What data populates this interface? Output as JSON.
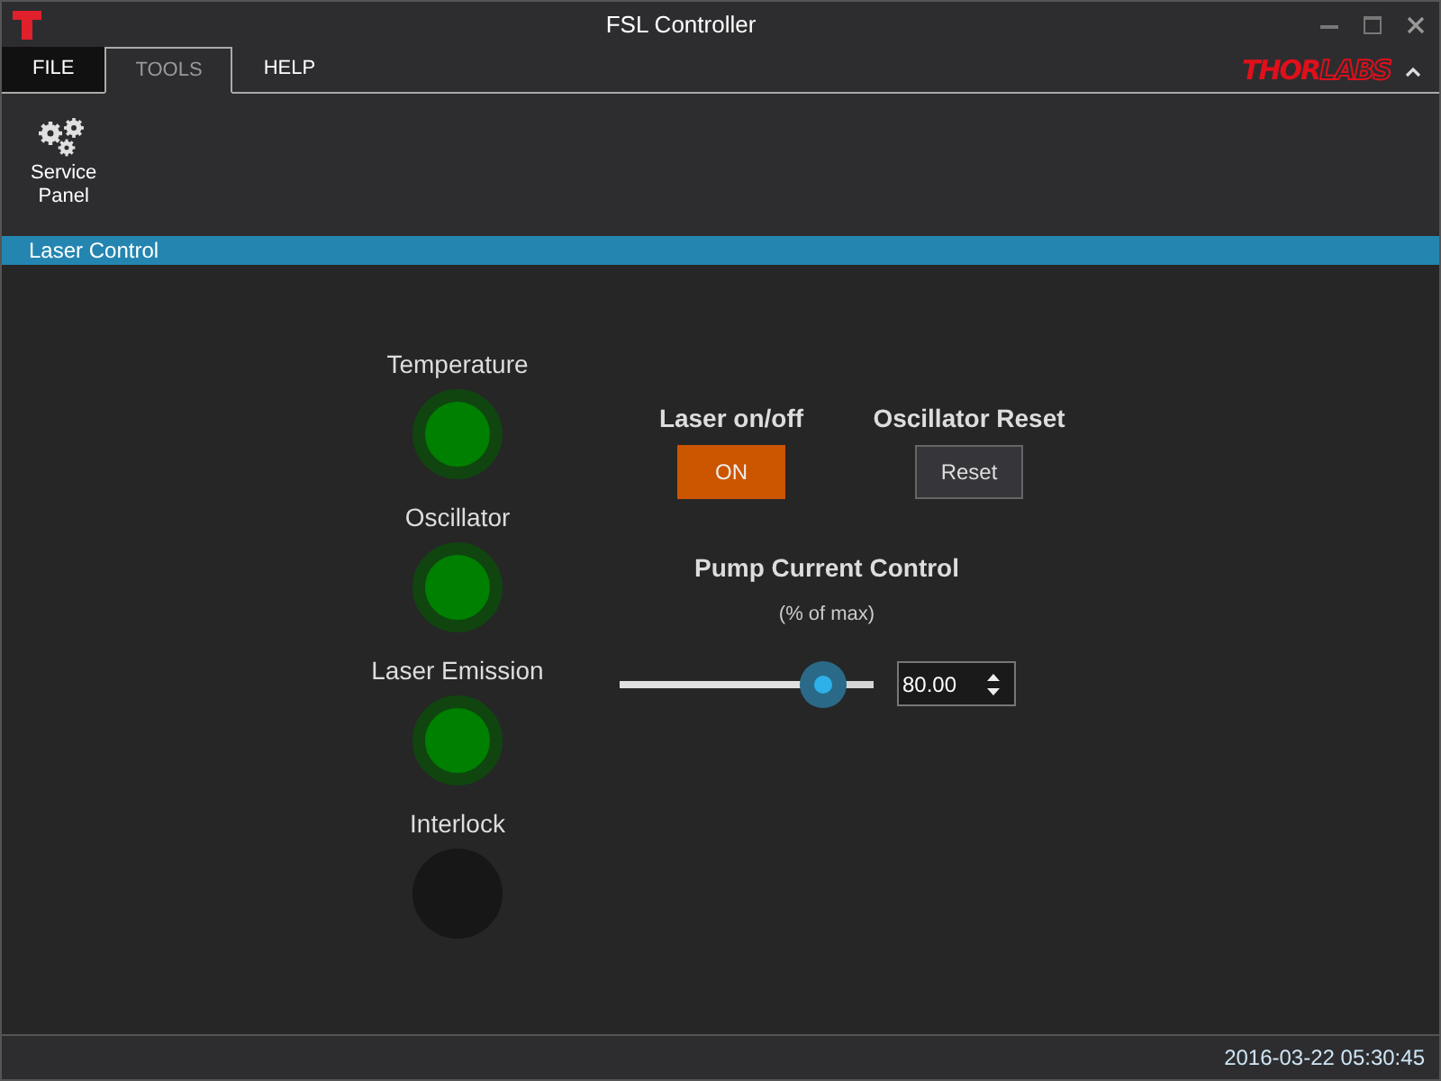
{
  "window": {
    "title": "FSL Controller"
  },
  "tabs": [
    {
      "label": "FILE",
      "selected": false,
      "kind": "file"
    },
    {
      "label": "TOOLS",
      "selected": true,
      "kind": "tab"
    },
    {
      "label": "HELP",
      "selected": false,
      "kind": "tab"
    }
  ],
  "brand": {
    "part_1": "THOR",
    "part_2": "LABS"
  },
  "ribbon": {
    "items": [
      {
        "label": "Service\nPanel"
      }
    ]
  },
  "section": {
    "title": "Laser Control"
  },
  "indicators": [
    {
      "label": "Temperature",
      "on": true
    },
    {
      "label": "Oscillator",
      "on": true
    },
    {
      "label": "Laser Emission",
      "on": true
    },
    {
      "label": "Interlock",
      "on": false
    }
  ],
  "laser": {
    "label": "Laser on/off",
    "button": "ON",
    "on": true
  },
  "oscillator_reset": {
    "label": "Oscillator Reset",
    "button": "Reset"
  },
  "pump": {
    "title": "Pump Current Control",
    "subtitle": "(% of max)",
    "level": 0.8,
    "value": "80.00"
  },
  "status_bar": {
    "datetime": "2016-03-22 05:30:45"
  }
}
